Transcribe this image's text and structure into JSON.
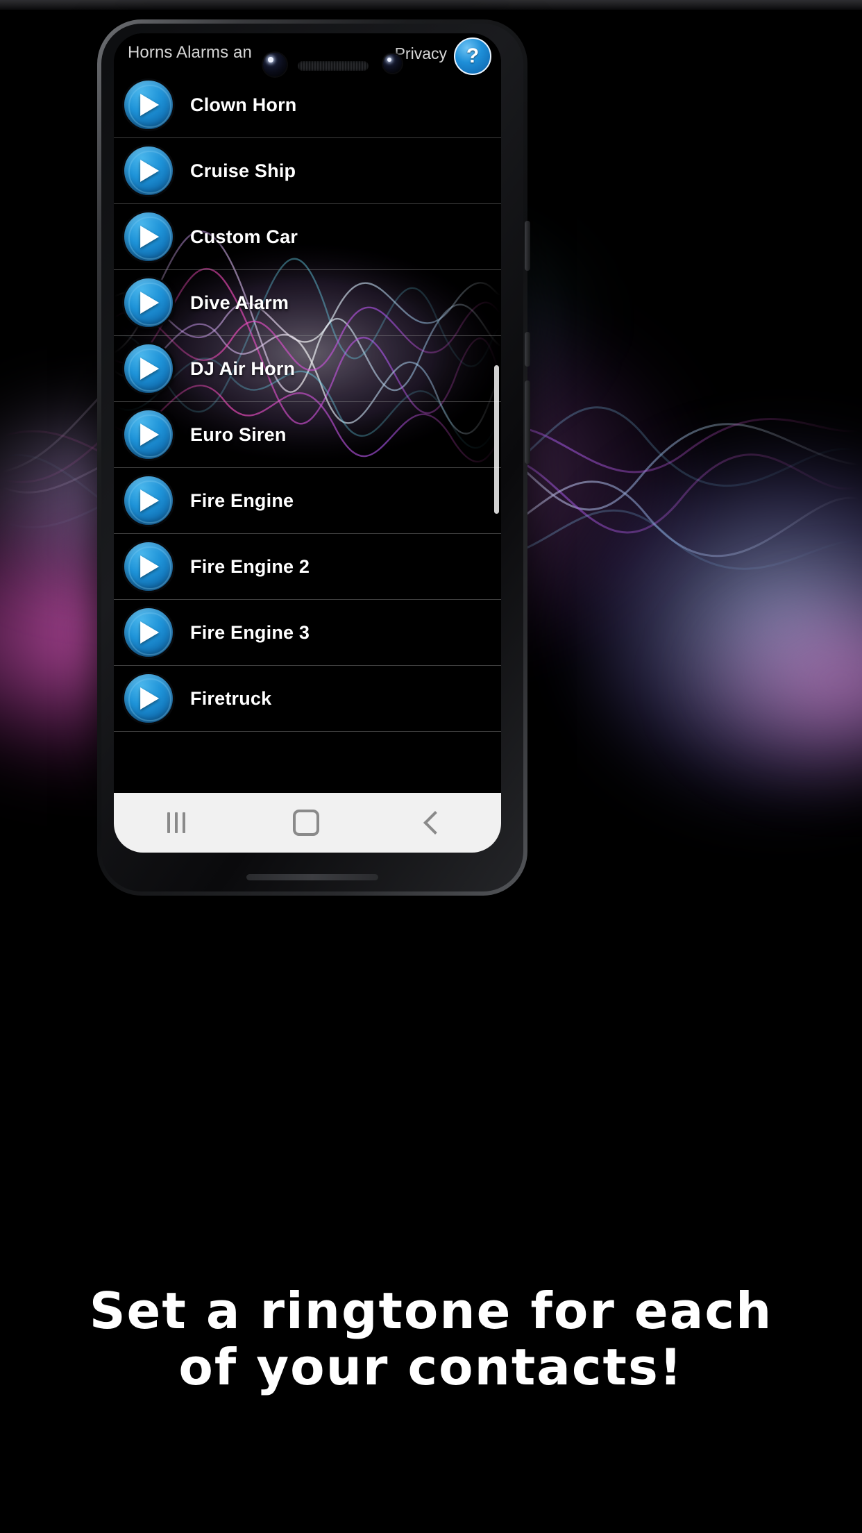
{
  "app": {
    "title": "Horns Alarms an",
    "privacy_label": "Privacy",
    "help_label": "?",
    "accent_color": "#1e93d8",
    "play_icon": "play-triangle-icon",
    "sounds": [
      {
        "name": "Clown Horn"
      },
      {
        "name": "Cruise Ship"
      },
      {
        "name": "Custom Car"
      },
      {
        "name": "Dive Alarm"
      },
      {
        "name": "DJ Air Horn"
      },
      {
        "name": "Euro Siren"
      },
      {
        "name": "Fire Engine"
      },
      {
        "name": "Fire Engine 2"
      },
      {
        "name": "Fire Engine 3"
      },
      {
        "name": "Firetruck"
      }
    ]
  },
  "navbar": {
    "recents_icon": "recents-icon",
    "home_icon": "home-icon",
    "back_icon": "back-icon"
  },
  "caption": {
    "line1": "Set a ringtone for each",
    "line2": "of your contacts!"
  }
}
